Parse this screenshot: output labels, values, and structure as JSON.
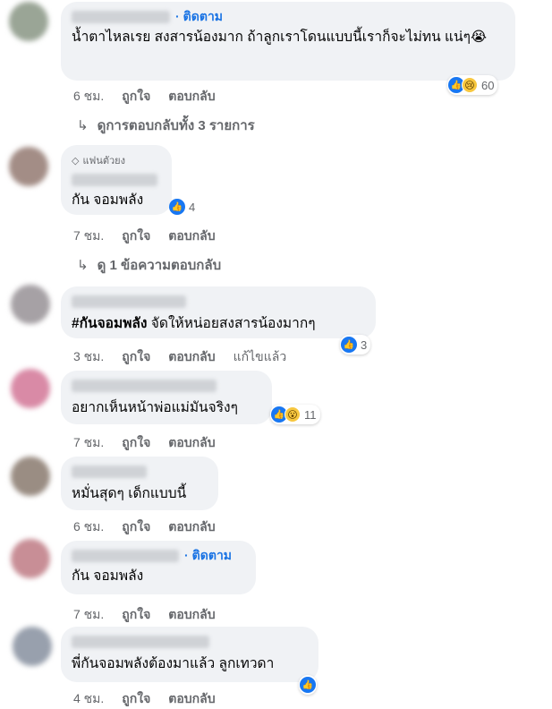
{
  "comments": [
    {
      "follow": "ติดตาม",
      "text": "น้ำตาไหลเรย สงสารน้องมาก ถ้าลูกเราโดนแบบนี้เราก็จะไม่ทน แน่ๆ😭",
      "time": "6 ชม.",
      "like": "ถูกใจ",
      "reply": "ตอบกลับ",
      "reaction_count": "60",
      "replies_text": "ดูการตอบกลับทั้ง 3 รายการ"
    },
    {
      "badge": "แฟนตัวยง",
      "text": "กัน จอมพลัง",
      "time": "7 ชม.",
      "like": "ถูกใจ",
      "reply": "ตอบกลับ",
      "reaction_count": "4",
      "replies_text": "ดู 1 ข้อความตอบกลับ"
    },
    {
      "text_bold": "#กันจอมพลัง",
      "text": " จัดให้หน่อยสงสารน้องมากๆ",
      "time": "3 ชม.",
      "like": "ถูกใจ",
      "reply": "ตอบกลับ",
      "edited": "แก้ไขแล้ว",
      "reaction_count": "3"
    },
    {
      "text": "อยากเห็นหน้าพ่อแม่มันจริงๆ",
      "time": "7 ชม.",
      "like": "ถูกใจ",
      "reply": "ตอบกลับ",
      "reaction_count": "11"
    },
    {
      "text": "หมั่นสุดๆ เด็กแบบนี้",
      "time": "6 ชม.",
      "like": "ถูกใจ",
      "reply": "ตอบกลับ"
    },
    {
      "follow": "ติดตาม",
      "text": "กัน จอมพลัง",
      "time": "7 ชม.",
      "like": "ถูกใจ",
      "reply": "ตอบกลับ"
    },
    {
      "text": "พี่กันจอมพลังต้องมาแล้ว ลูกเทวดา",
      "time": "4 ชม.",
      "like": "ถูกใจ",
      "reply": "ตอบกลับ"
    }
  ],
  "colors": {
    "bubble": "#f0f2f5",
    "link": "#1b74e4",
    "meta": "#65676b",
    "like": "#1877f2"
  }
}
